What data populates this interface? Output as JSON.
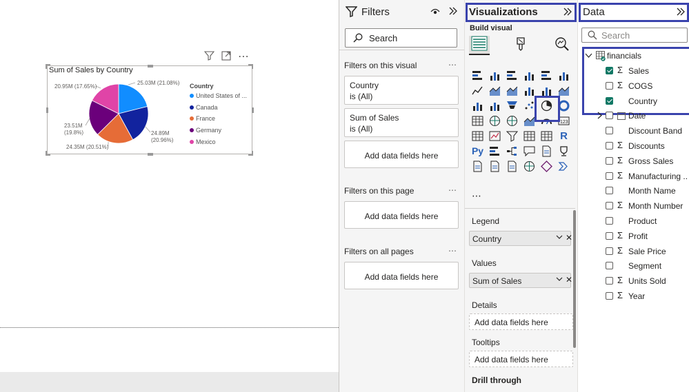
{
  "visual": {
    "title": "Sum of Sales by Country",
    "legend": {
      "title": "Country",
      "items": [
        {
          "label": "United States of ...",
          "color": "#118dff"
        },
        {
          "label": "Canada",
          "color": "#12239e"
        },
        {
          "label": "France",
          "color": "#e66c37"
        },
        {
          "label": "Germany",
          "color": "#6b007b"
        },
        {
          "label": "Mexico",
          "color": "#e044a7"
        }
      ]
    },
    "data_labels": {
      "us": "25.03M (21.08%)",
      "canada_value": "24.89M",
      "canada_pct": "(20.96%)",
      "france": "24.35M (20.51%)",
      "germany_value": "23.51M",
      "germany_pct": "(19.8%)",
      "mexico": "20.95M (17.65%)"
    },
    "toolbar": {
      "filter_icon": "filter-icon",
      "focus_icon": "focus-mode-icon",
      "more": "⋯"
    }
  },
  "chart_data": {
    "type": "pie",
    "title": "Sum of Sales by Country",
    "categories": [
      "United States of America",
      "Canada",
      "France",
      "Germany",
      "Mexico"
    ],
    "values": [
      25.03,
      24.89,
      24.35,
      23.51,
      20.95
    ],
    "percentages": [
      21.08,
      20.96,
      20.51,
      19.8,
      17.65
    ],
    "unit": "M",
    "colors": [
      "#118dff",
      "#12239e",
      "#e66c37",
      "#6b007b",
      "#e044a7"
    ],
    "legend_title": "Country",
    "legend_position": "right"
  },
  "filters": {
    "title": "Filters",
    "search_placeholder": "Search",
    "on_visual": {
      "title": "Filters on this visual",
      "more": "⋯",
      "cards": [
        {
          "name": "Country",
          "state": "is (All)"
        },
        {
          "name": "Sum of Sales",
          "state": "is (All)"
        }
      ],
      "add": "Add data fields here"
    },
    "on_page": {
      "title": "Filters on this page",
      "more": "⋯",
      "add": "Add data fields here"
    },
    "on_all": {
      "title": "Filters on all pages",
      "more": "⋯",
      "add": "Add data fields here"
    }
  },
  "viz": {
    "title": "Visualizations",
    "build_label": "Build visual",
    "more": "⋯",
    "wells": {
      "legend": {
        "label": "Legend",
        "field": "Country"
      },
      "values": {
        "label": "Values",
        "field": "Sum of Sales"
      },
      "details": {
        "label": "Details",
        "add": "Add data fields here"
      },
      "tooltips": {
        "label": "Tooltips",
        "add": "Add data fields here"
      },
      "drill": {
        "label": "Drill through"
      }
    },
    "icons": [
      "stacked-bar-icon",
      "stacked-column-icon",
      "clustered-bar-icon",
      "clustered-column-icon",
      "100-bar-icon",
      "100-column-icon",
      "line-chart-icon",
      "area-chart-icon",
      "stacked-area-icon",
      "line-column-icon",
      "line-clustered-icon",
      "ribbon-icon",
      "waterfall-icon",
      "funnel-icon",
      "funnel2-icon",
      "scatter-icon",
      "pie-chart-icon",
      "donut-icon",
      "treemap-icon",
      "map-icon",
      "filled-map-icon",
      "azure-map-icon",
      "gauge-icon",
      "card-icon",
      "multirow-card-icon",
      "kpi-icon",
      "slicer-icon",
      "table-icon",
      "matrix-icon",
      "r-visual-icon",
      "python-visual-icon",
      "key-influencers-icon",
      "decomposition-tree-icon",
      "qa-icon",
      "narrative-icon",
      "goals-icon",
      "paginated-report-icon",
      "power-apps-icon",
      "power-automate-icon",
      "map2-icon",
      "diamond-icon",
      "chevron-icon"
    ],
    "r_label": "R",
    "py_label": "Py"
  },
  "data": {
    "title": "Data",
    "search_placeholder": "Search",
    "table": "financials",
    "fields": [
      {
        "label": "Sales",
        "sigma": true,
        "checked": true
      },
      {
        "label": "COGS",
        "sigma": true,
        "checked": false
      },
      {
        "label": "Country",
        "sigma": false,
        "checked": true
      },
      {
        "label": "Date",
        "sigma": false,
        "checked": false,
        "date": true
      },
      {
        "label": "Discount Band",
        "sigma": false,
        "checked": false
      },
      {
        "label": "Discounts",
        "sigma": true,
        "checked": false
      },
      {
        "label": "Gross Sales",
        "sigma": true,
        "checked": false
      },
      {
        "label": "Manufacturing ...",
        "sigma": true,
        "checked": false
      },
      {
        "label": "Month Name",
        "sigma": false,
        "checked": false
      },
      {
        "label": "Month Number",
        "sigma": true,
        "checked": false
      },
      {
        "label": "Product",
        "sigma": false,
        "checked": false
      },
      {
        "label": "Profit",
        "sigma": true,
        "checked": false
      },
      {
        "label": "Sale Price",
        "sigma": true,
        "checked": false
      },
      {
        "label": "Segment",
        "sigma": false,
        "checked": false
      },
      {
        "label": "Units Sold",
        "sigma": true,
        "checked": false
      },
      {
        "label": "Year",
        "sigma": true,
        "checked": false
      }
    ],
    "sigma_glyph": "Σ"
  },
  "colors": {
    "accent_box": "#3a43ad",
    "checkbox_on": "#117865"
  }
}
